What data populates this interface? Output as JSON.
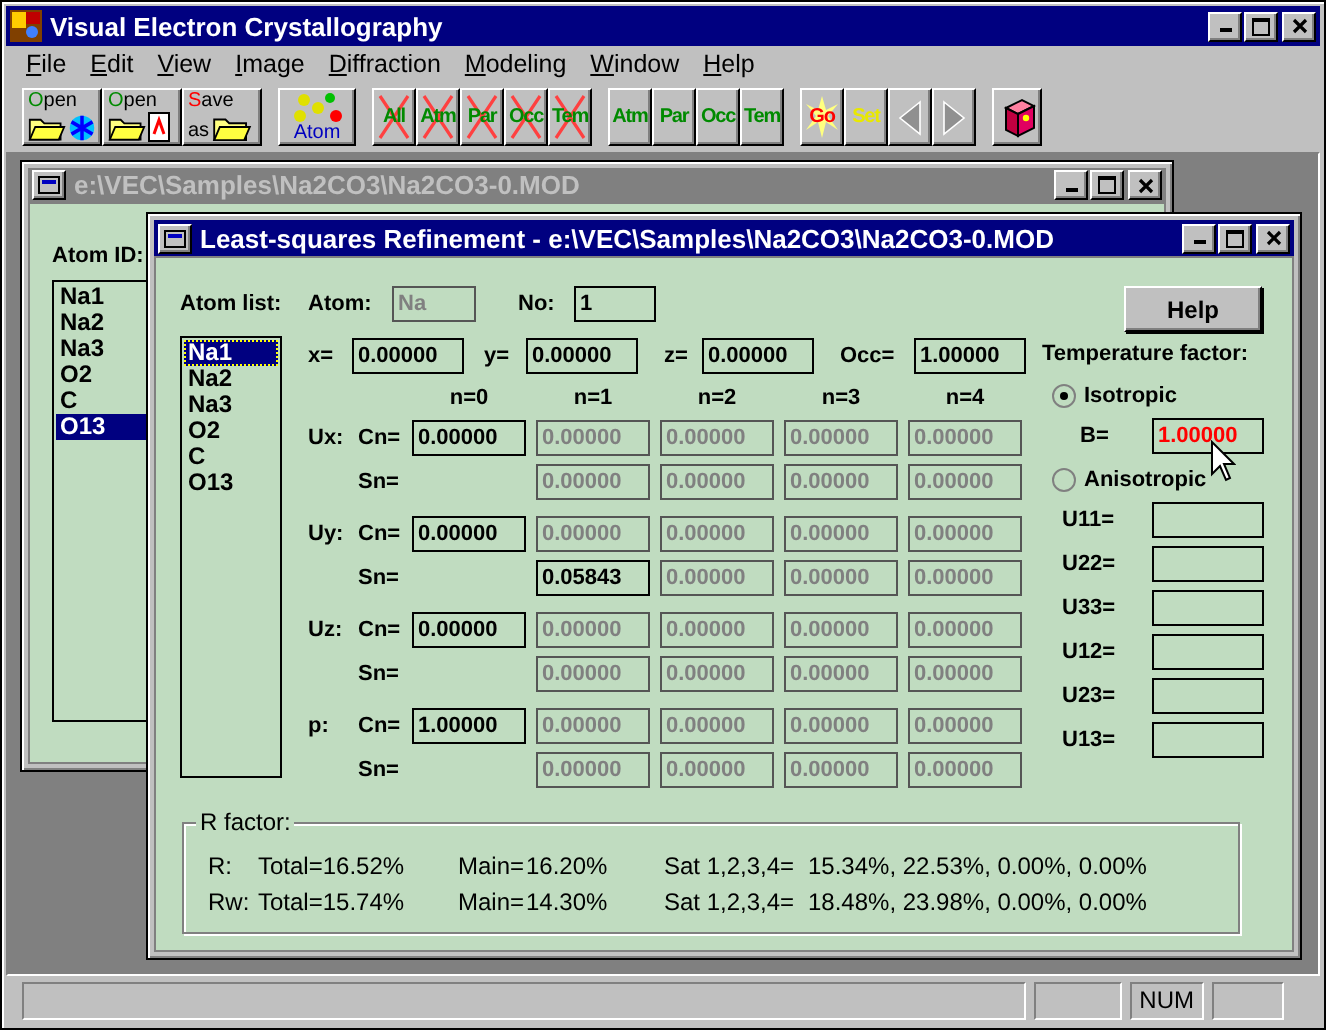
{
  "window": {
    "title": "Visual Electron Crystallography"
  },
  "menu": [
    "File",
    "Edit",
    "View",
    "Image",
    "Diffraction",
    "Modeling",
    "Window",
    "Help"
  ],
  "toolbar": [
    [
      {
        "kind": "open-model",
        "label": "Open"
      },
      {
        "kind": "open-image",
        "label": "Open"
      },
      {
        "kind": "save",
        "label": "Save",
        "sublabel": "as"
      }
    ],
    [
      {
        "kind": "atom",
        "label": "Atom"
      }
    ],
    [
      {
        "kind": "clear",
        "label": "All"
      },
      {
        "kind": "clear",
        "label": "Atm"
      },
      {
        "kind": "clear",
        "label": "Par"
      },
      {
        "kind": "clear",
        "label": "Occ"
      },
      {
        "kind": "clear",
        "label": "Tem"
      }
    ],
    [
      {
        "kind": "refine",
        "label": "Atm"
      },
      {
        "kind": "refine",
        "label": "Par"
      },
      {
        "kind": "refine",
        "label": "Occ"
      },
      {
        "kind": "refine",
        "label": "Tem"
      }
    ],
    [
      {
        "kind": "go",
        "label": "Go"
      },
      {
        "kind": "set",
        "label": "Set"
      },
      {
        "kind": "prev",
        "disabled": true
      },
      {
        "kind": "next",
        "disabled": true
      }
    ],
    [
      {
        "kind": "help-book"
      }
    ]
  ],
  "back_window": {
    "title": "e:\\VEC\\Samples\\Na2CO3\\Na2CO3-0.MOD",
    "atom_id_label": "Atom ID:",
    "atoms": [
      {
        "label": "Na1",
        "selected": false
      },
      {
        "label": "Na2",
        "selected": false
      },
      {
        "label": "Na3",
        "selected": false
      },
      {
        "label": "O2",
        "selected": false
      },
      {
        "label": "C",
        "selected": false
      },
      {
        "label": "O13",
        "selected": true
      }
    ]
  },
  "dialog": {
    "title": "Least-squares Refinement - e:\\VEC\\Samples\\Na2CO3\\Na2CO3-0.MOD",
    "atom_list_label": "Atom list:",
    "atoms": [
      {
        "label": "Na1",
        "selected": true
      },
      {
        "label": "Na2",
        "selected": false
      },
      {
        "label": "Na3",
        "selected": false
      },
      {
        "label": "O2",
        "selected": false
      },
      {
        "label": "C",
        "selected": false
      },
      {
        "label": "O13",
        "selected": false
      }
    ],
    "atom_label": "Atom:",
    "atom_field": {
      "value": "Na",
      "disabled": true
    },
    "no_label": "No:",
    "no_field": {
      "value": "1",
      "disabled": false
    },
    "coords": [
      {
        "label": "x=",
        "value": "0.00000"
      },
      {
        "label": "y=",
        "value": "0.00000"
      },
      {
        "label": "z=",
        "value": "0.00000"
      },
      {
        "label": "Occ=",
        "value": "1.00000"
      }
    ],
    "columns": [
      "n=0",
      "n=1",
      "n=2",
      "n=3",
      "n=4"
    ],
    "params": [
      {
        "label": "Ux:",
        "rows": [
          {
            "label": "Cn=",
            "cells": [
              {
                "value": "0.00000",
                "disabled": false
              },
              {
                "value": "0.00000",
                "disabled": true
              },
              {
                "value": "0.00000",
                "disabled": true
              },
              {
                "value": "0.00000",
                "disabled": true
              },
              {
                "value": "0.00000",
                "disabled": true
              }
            ]
          },
          {
            "label": "Sn=",
            "cells": [
              "",
              {
                "value": "0.00000",
                "disabled": true
              },
              {
                "value": "0.00000",
                "disabled": true
              },
              {
                "value": "0.00000",
                "disabled": true
              },
              {
                "value": "0.00000",
                "disabled": true
              }
            ]
          }
        ]
      },
      {
        "label": "Uy:",
        "rows": [
          {
            "label": "Cn=",
            "cells": [
              {
                "value": "0.00000",
                "disabled": false
              },
              {
                "value": "0.00000",
                "disabled": true
              },
              {
                "value": "0.00000",
                "disabled": true
              },
              {
                "value": "0.00000",
                "disabled": true
              },
              {
                "value": "0.00000",
                "disabled": true
              }
            ]
          },
          {
            "label": "Sn=",
            "cells": [
              "",
              {
                "value": "0.05843",
                "disabled": false
              },
              {
                "value": "0.00000",
                "disabled": true
              },
              {
                "value": "0.00000",
                "disabled": true
              },
              {
                "value": "0.00000",
                "disabled": true
              }
            ]
          }
        ]
      },
      {
        "label": "Uz:",
        "rows": [
          {
            "label": "Cn=",
            "cells": [
              {
                "value": "0.00000",
                "disabled": false
              },
              {
                "value": "0.00000",
                "disabled": true
              },
              {
                "value": "0.00000",
                "disabled": true
              },
              {
                "value": "0.00000",
                "disabled": true
              },
              {
                "value": "0.00000",
                "disabled": true
              }
            ]
          },
          {
            "label": "Sn=",
            "cells": [
              "",
              {
                "value": "0.00000",
                "disabled": true
              },
              {
                "value": "0.00000",
                "disabled": true
              },
              {
                "value": "0.00000",
                "disabled": true
              },
              {
                "value": "0.00000",
                "disabled": true
              }
            ]
          }
        ]
      },
      {
        "label": "p:",
        "rows": [
          {
            "label": "Cn=",
            "cells": [
              {
                "value": "1.00000",
                "disabled": false
              },
              {
                "value": "0.00000",
                "disabled": true
              },
              {
                "value": "0.00000",
                "disabled": true
              },
              {
                "value": "0.00000",
                "disabled": true
              },
              {
                "value": "0.00000",
                "disabled": true
              }
            ]
          },
          {
            "label": "Sn=",
            "cells": [
              "",
              {
                "value": "0.00000",
                "disabled": true
              },
              {
                "value": "0.00000",
                "disabled": true
              },
              {
                "value": "0.00000",
                "disabled": true
              },
              {
                "value": "0.00000",
                "disabled": true
              }
            ]
          }
        ]
      }
    ],
    "help_button": "Help",
    "temperature": {
      "label": "Temperature factor:",
      "modes": [
        {
          "label": "Isotropic",
          "selected": true
        },
        {
          "label": "Anisotropic",
          "selected": false
        }
      ],
      "b": {
        "label": "B=",
        "value": "1.00000",
        "highlighted": true
      },
      "u": [
        {
          "label": "U11="
        },
        {
          "label": "U22="
        },
        {
          "label": "U33="
        },
        {
          "label": "U12="
        },
        {
          "label": "U23="
        },
        {
          "label": "U13="
        }
      ]
    },
    "r_factor": {
      "title": "R factor:",
      "rows": [
        {
          "label": "R:",
          "total": "Total=16.52%",
          "main_label": "Main=",
          "main": "16.20%",
          "sat_label": "Sat 1,2,3,4=",
          "sat": "15.34%, 22.53%, 0.00%, 0.00%"
        },
        {
          "label": "Rw:",
          "total": "Total=15.74%",
          "main_label": "Main=",
          "main": "14.30%",
          "sat_label": "Sat 1,2,3,4=",
          "sat": "18.48%, 23.98%, 0.00%, 0.00%"
        }
      ]
    }
  },
  "status_bar": {
    "num": "NUM"
  }
}
